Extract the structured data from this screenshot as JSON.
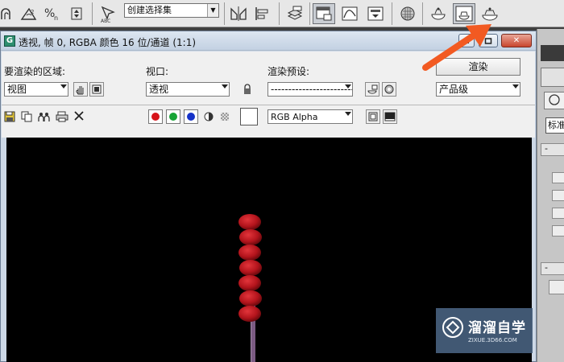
{
  "toolbar": {
    "named_selection_placeholder": "创建选择集",
    "icons": [
      "pan-view-icon",
      "snaps-toggle-icon",
      "angle-snap-icon",
      "percent-snap-icon",
      "spinner-snap-icon",
      "edit-named-selection-icon",
      "mirror-icon",
      "align-icon",
      "layer-manager-icon",
      "render-setup-icon",
      "curve-editor-icon",
      "schematic-view-icon",
      "material-editor-icon",
      "render-frame-window-icon",
      "rendered-frame-icon",
      "render-production-icon"
    ]
  },
  "render_window": {
    "title": "透视, 帧 0, RGBA 颜色 16 位/通道 (1:1)",
    "area_label": "要渲染的区域:",
    "area_value": "视图",
    "viewport_label": "视口:",
    "viewport_value": "透视",
    "preset_label": "渲染预设:",
    "preset_value": "-------------------------",
    "render_button": "渲染",
    "render_mode": "产品级",
    "channel_display": "RGB Alpha",
    "channel_colors": {
      "red": "#d7141a",
      "green": "#17a335",
      "blue": "#1632c8"
    }
  },
  "command_panel": {
    "name_field": "标准"
  },
  "render_scene": {
    "background": "#000000",
    "candy_color": "#c0151c",
    "stick_color": "#7b5b82",
    "candy_count": 7
  },
  "watermark": {
    "title": "溜溜自学",
    "subtitle": "ZIXUE.3D66.COM"
  },
  "annotation": {
    "arrow_color": "#f25a22"
  }
}
